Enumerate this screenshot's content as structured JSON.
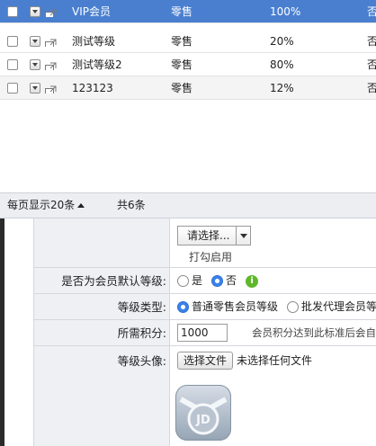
{
  "grid": {
    "rows": [
      {
        "name": "VIP会员",
        "type": "零售",
        "pct": "100%",
        "last": "否",
        "style": "selected"
      },
      {
        "name": "测试等级",
        "type": "零售",
        "pct": "20%",
        "last": "否",
        "style": "plain"
      },
      {
        "name": "测试等级2",
        "type": "零售",
        "pct": "80%",
        "last": "否",
        "style": "plain"
      },
      {
        "name": "123123",
        "type": "零售",
        "pct": "12%",
        "last": "否",
        "style": "alt"
      }
    ]
  },
  "pager": {
    "per_page": "每页显示20条",
    "total": "共6条"
  },
  "form": {
    "select_placeholder": "请选择...",
    "check_enable": "打勾启用",
    "default_label": "是否为会员默认等级:",
    "opt_yes": "是",
    "opt_no": "否",
    "level_type_label": "等级类型:",
    "type_retail": "普通零售会员等级",
    "type_wholesale": "批发代理会员等",
    "points_label": "所需积分:",
    "points_value": "1000",
    "points_hint": "会员积分达到此标准后会自",
    "avatar_label": "等级头像:",
    "choose_file": "选择文件",
    "no_file": "未选择任何文件",
    "avatar_logo_text": "JD"
  }
}
